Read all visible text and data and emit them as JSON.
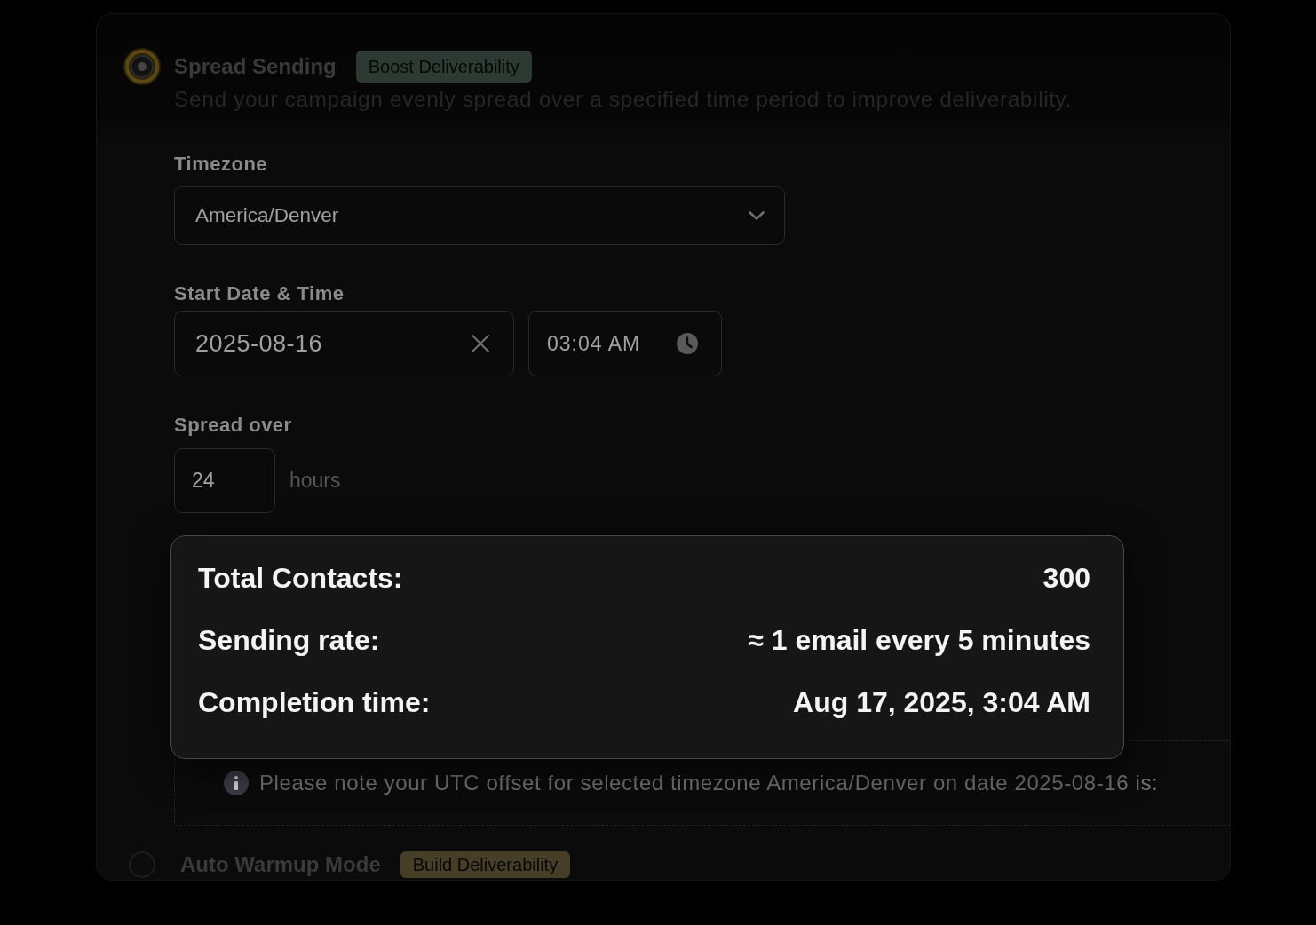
{
  "sending_options": [
    {
      "title": "Spread Sending",
      "badge": {
        "label": "Boost Deliverability",
        "color": "#2c3a32"
      },
      "selected": true,
      "description": "Send your campaign evenly spread over a specified time period to improve deliverability.",
      "settings": {
        "timezone": {
          "label": "Timezone",
          "value": "America/Denver"
        },
        "start": {
          "label": "Start Date & Time",
          "date": "2025-08-16",
          "time": "03:04 AM"
        },
        "spread": {
          "label": "Spread over",
          "value": "24",
          "unit": "hours"
        },
        "note": "Please note your UTC offset for selected timezone America/Denver on date 2025-08-16 is:"
      }
    },
    {
      "title": "Auto Warmup Mode",
      "badge": {
        "label": "Build Deliverability",
        "color": "#463e26"
      },
      "selected": false
    }
  ],
  "summary": {
    "rows": [
      {
        "label": "Total Contacts:",
        "value": "300"
      },
      {
        "label": "Sending rate:",
        "value": "≈ 1 email every 5 minutes"
      },
      {
        "label": "Completion time:",
        "value": "Aug 17, 2025, 3:04 AM"
      }
    ]
  }
}
